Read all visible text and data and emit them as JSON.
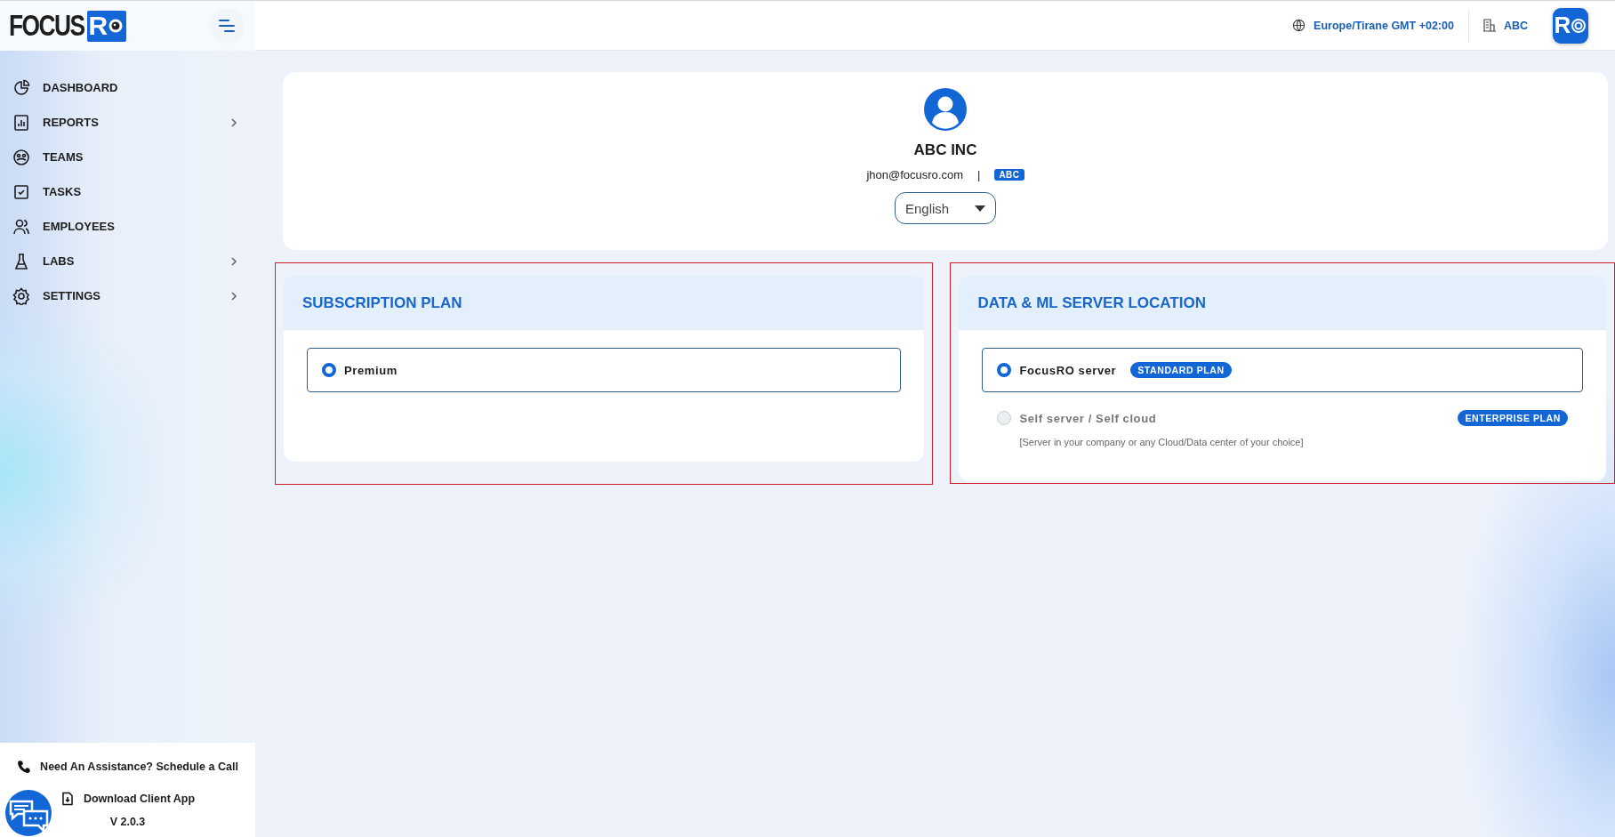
{
  "logo": {
    "text": "FOCUS",
    "badge": "R"
  },
  "sidebar": {
    "items": [
      {
        "label": "DASHBOARD",
        "expandable": false
      },
      {
        "label": "REPORTS",
        "expandable": true
      },
      {
        "label": "TEAMS",
        "expandable": false
      },
      {
        "label": "TASKS",
        "expandable": false
      },
      {
        "label": "EMPLOYEES",
        "expandable": false
      },
      {
        "label": "LABS",
        "expandable": true
      },
      {
        "label": "SETTINGS",
        "expandable": true
      }
    ]
  },
  "footer": {
    "assist": "Need An Assistance? Schedule a Call",
    "download": "Download Client App",
    "version": "V 2.0.3"
  },
  "header": {
    "timezone": "Europe/Tirane GMT +02:00",
    "company": "ABC",
    "avatar": "R"
  },
  "profile": {
    "name": "ABC INC",
    "email": "jhon@focusro.com",
    "separator": "|",
    "tag": "ABC",
    "language": "English"
  },
  "panels": [
    {
      "title": "SUBSCRIPTION PLAN",
      "options": [
        {
          "label": "Premium",
          "selected": true
        }
      ]
    },
    {
      "title": "DATA & ML SERVER LOCATION",
      "options": [
        {
          "label": "FocusRO server",
          "badge": "STANDARD PLAN",
          "selected": true
        },
        {
          "label": "Self server / Self cloud",
          "badge": "ENTERPRISE PLAN",
          "note": "[Server in your company or any Cloud/Data center of your choice]",
          "selected": false
        }
      ]
    }
  ]
}
